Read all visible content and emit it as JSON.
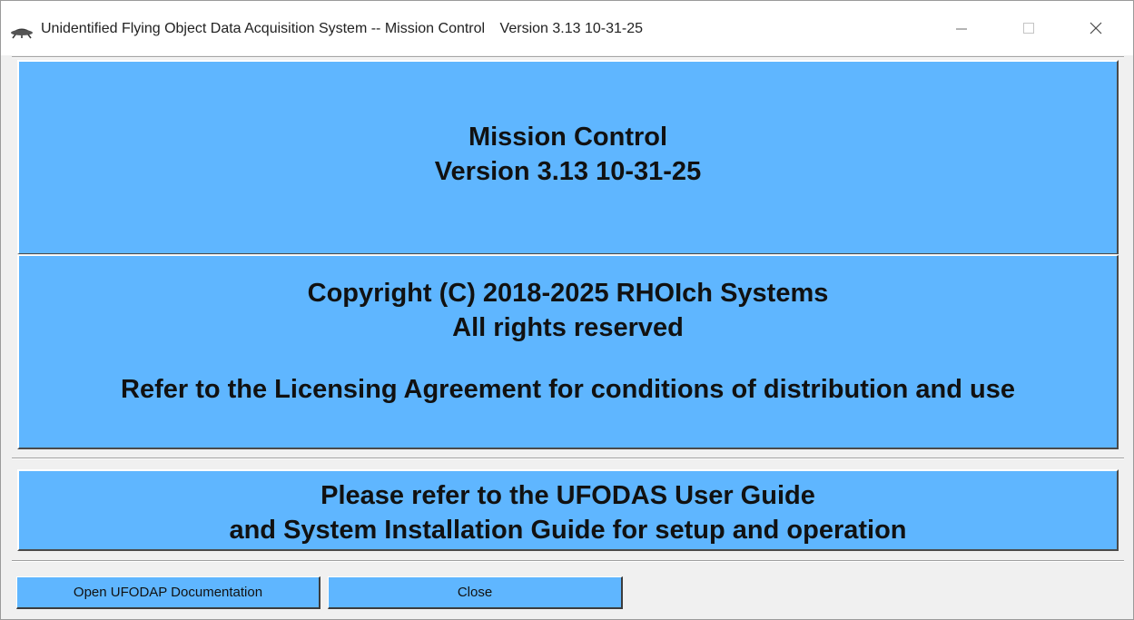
{
  "window": {
    "title": "Unidentified Flying Object Data Acquisition System -- Mission Control",
    "version_label": "Version 3.13 10-31-25",
    "app_icon": "ufo-icon",
    "controls": {
      "minimize_icon": "minimize-icon",
      "maximize_icon": "maximize-icon",
      "close_icon": "close-icon"
    }
  },
  "header_panel": {
    "line1": "Mission Control",
    "line2": "Version 3.13 10-31-25"
  },
  "copyright_panel": {
    "line1": "Copyright (C) 2018-2025 RHOIch Systems",
    "line2": "All rights reserved",
    "line3": "Refer to the Licensing Agreement for conditions of distribution and use"
  },
  "guide_panel": {
    "line1": "Please refer to the UFODAS User Guide",
    "line2": "and System Installation Guide for setup and operation"
  },
  "buttons": {
    "docs_label": "Open UFODAP Documentation",
    "close_label": "Close"
  },
  "colors": {
    "panel_blue": "#5fb6ff",
    "window_bg": "#f0f0f0"
  }
}
